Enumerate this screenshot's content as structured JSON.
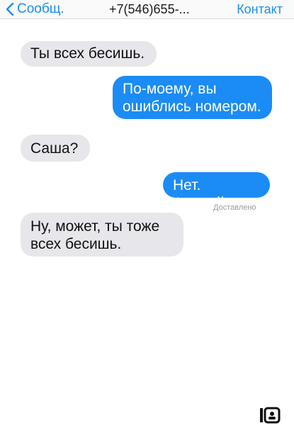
{
  "nav": {
    "back_label": "Сообщ.",
    "title": "+7(546)655-...",
    "contact_label": "Контакт"
  },
  "messages": [
    {
      "direction": "incoming",
      "text": "Ты всех бесишь."
    },
    {
      "direction": "outgoing",
      "text": "По-моему, вы\nошиблись номером."
    },
    {
      "direction": "incoming",
      "text": "Саша?"
    },
    {
      "direction": "outgoing",
      "text": "Нет. Андрей."
    },
    {
      "direction": "incoming",
      "text": "Ну, может, ты тоже\nвсех бесишь."
    }
  ],
  "status": {
    "delivered": "Доставлено"
  },
  "icons": {
    "back": "chevron-left-icon",
    "watermark": "site-logo-icon"
  },
  "colors": {
    "accent": "#1b8cf5",
    "incoming_bubble": "#e6e6eb",
    "link": "#1a8ef3"
  }
}
